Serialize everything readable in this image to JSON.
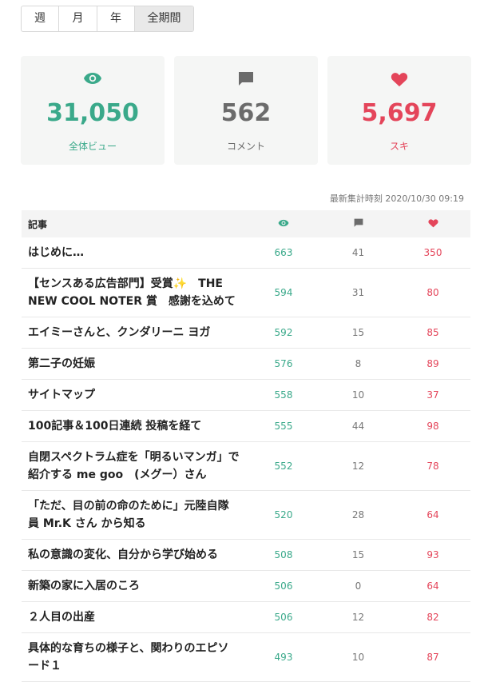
{
  "period_tabs": [
    "週",
    "月",
    "年",
    "全期間"
  ],
  "summary": {
    "views": {
      "value": "31,050",
      "label": "全体ビュー",
      "icon": "eye-icon",
      "color": "#3aa98a"
    },
    "comments": {
      "value": "562",
      "label": "コメント",
      "icon": "comment-icon",
      "color": "#6b6b6b"
    },
    "likes": {
      "value": "5,697",
      "label": "スキ",
      "icon": "heart-icon",
      "color": "#e4455a"
    }
  },
  "updated": "最新集計時刻 2020/10/30 09:19",
  "table": {
    "header": "記事",
    "rows": [
      {
        "title": "はじめに…",
        "views": "663",
        "comments": "41",
        "likes": "350"
      },
      {
        "title": "【センスある広告部門】受賞✨　THE NEW COOL NOTER 賞　感謝を込めて",
        "views": "594",
        "comments": "31",
        "likes": "80"
      },
      {
        "title": "エイミーさんと、クンダリーニ ヨガ",
        "views": "592",
        "comments": "15",
        "likes": "85"
      },
      {
        "title": "第二子の妊娠",
        "views": "576",
        "comments": "8",
        "likes": "89"
      },
      {
        "title": "サイトマップ",
        "views": "558",
        "comments": "10",
        "likes": "37"
      },
      {
        "title": "100記事＆100日連続 投稿を経て",
        "views": "555",
        "comments": "44",
        "likes": "98"
      },
      {
        "title": "自閉スペクトラム症を「明るいマンガ」で紹介する me goo　(メグー）さん",
        "views": "552",
        "comments": "12",
        "likes": "78"
      },
      {
        "title": "「ただ、目の前の命のために」元陸自隊員 Mr.K さん から知る",
        "views": "520",
        "comments": "28",
        "likes": "64"
      },
      {
        "title": "私の意識の変化、自分から学び始める",
        "views": "508",
        "comments": "15",
        "likes": "93"
      },
      {
        "title": "新築の家に入居のころ",
        "views": "506",
        "comments": "0",
        "likes": "64"
      },
      {
        "title": "２人目の出産",
        "views": "506",
        "comments": "12",
        "likes": "82"
      },
      {
        "title": "具体的な育ちの様子と、関わりのエピソード１",
        "views": "493",
        "comments": "10",
        "likes": "87"
      }
    ]
  }
}
